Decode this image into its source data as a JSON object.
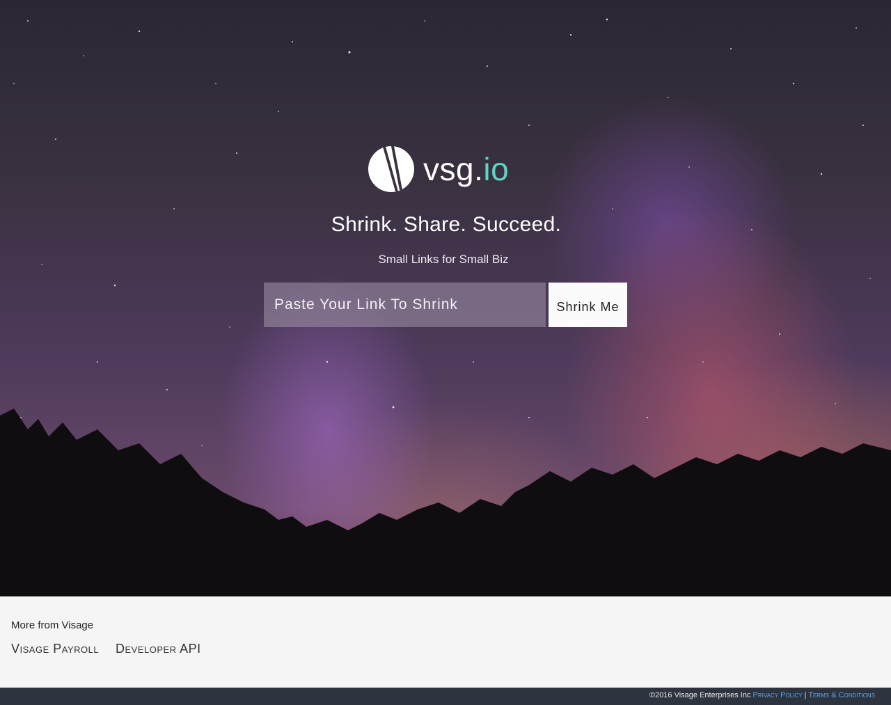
{
  "brand": {
    "name": "vsg.",
    "tld": "io",
    "accent_color": "#5ad7c6"
  },
  "hero": {
    "tagline": "Shrink. Share. Succeed.",
    "subtagline": "Small Links for Small Biz",
    "input_placeholder": "Paste Your Link To Shrink",
    "button_label": "Shrink Me"
  },
  "more": {
    "title": "More from Visage",
    "links": [
      "Visage Payroll",
      "Developer API"
    ]
  },
  "footer": {
    "copyright": "©2016 Visage Enterprises Inc",
    "privacy_label": "Privacy Policy",
    "separator": "|",
    "terms_label": "Terms & Conditions",
    "link_color": "#5aa9e6",
    "background": "#2e3340"
  }
}
